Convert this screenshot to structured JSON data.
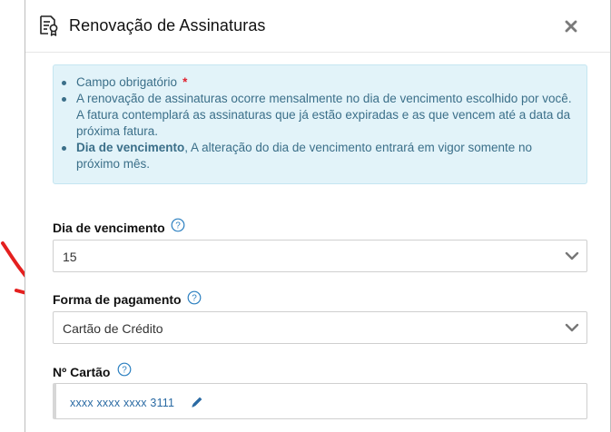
{
  "header": {
    "title": "Renovação de Assinaturas",
    "icon": "document-badge-icon",
    "close_icon": "close-icon"
  },
  "info": {
    "items": [
      {
        "text": "Campo obrigatório",
        "required_marker": "*"
      },
      {
        "text": "A renovação de assinaturas ocorre mensalmente no dia de vencimento escolhido por você. A fatura contemplará as assinaturas que já estão expiradas e as que vencem até a data da próxima fatura."
      },
      {
        "bold": "Dia de vencimento",
        "text": ", A alteração do dia de vencimento entrará em vigor somente no próximo mês."
      }
    ]
  },
  "fields": {
    "due_day": {
      "label": "Dia de vencimento",
      "value": "15"
    },
    "payment_method": {
      "label": "Forma de pagamento",
      "value": "Cartão de Crédito"
    },
    "card_number": {
      "label": "Nº Cartão",
      "value": "xxxx xxxx xxxx 3111"
    }
  },
  "colors": {
    "info_background": "#e2f3f9",
    "info_text": "#3b6f89",
    "link_blue": "#2a6aa3",
    "required_red": "#e0222f",
    "annotation_arrow": "#e4201f"
  }
}
